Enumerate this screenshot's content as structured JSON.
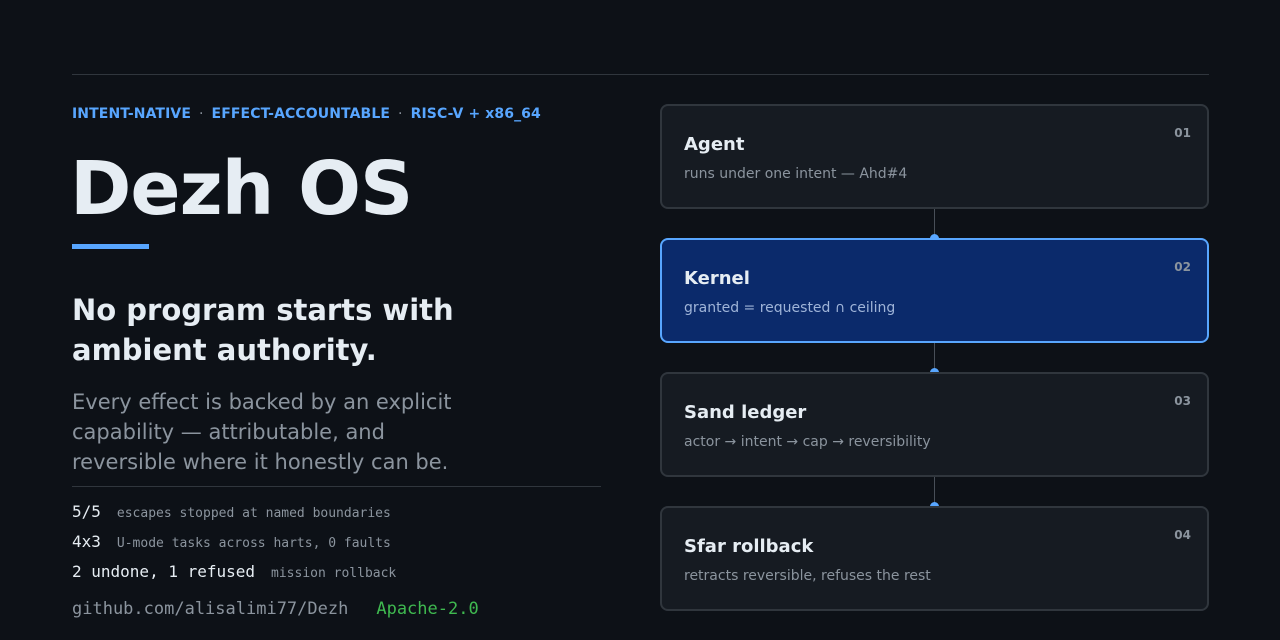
{
  "tagline": {
    "items": [
      "INTENT-NATIVE",
      "EFFECT-ACCOUNTABLE",
      "RISC-V + x86_64"
    ],
    "separator": "·"
  },
  "title": "Dezh OS",
  "headline": "No program starts with ambient authority.",
  "lede": "Every effect is backed by an explicit capability — attributable, and reversible where it honestly can be.",
  "stats": [
    {
      "value": "5/5",
      "desc": "escapes stopped at named boundaries"
    },
    {
      "value": "4x3",
      "desc": "U-mode tasks across harts, 0 faults"
    },
    {
      "value": "2 undone, 1 refused",
      "desc": "mission rollback"
    }
  ],
  "footer": {
    "repo": "github.com/alisalimi77/Dezh",
    "license": "Apache-2.0"
  },
  "pipeline": [
    {
      "num": "01",
      "title": "Agent",
      "subtitle": "runs under one intent — Ahd#4",
      "active": false
    },
    {
      "num": "02",
      "title": "Kernel",
      "subtitle": "granted = requested ∩ ceiling",
      "active": true
    },
    {
      "num": "03",
      "title": "Sand ledger",
      "subtitle": "actor → intent → cap → reversibility",
      "active": false
    },
    {
      "num": "04",
      "title": "Sfar rollback",
      "subtitle": "retracts reversible, refuses the rest",
      "active": false
    }
  ],
  "colors": {
    "background": "#0d1117",
    "accent": "#58a6ff",
    "active_step": "#0b2a6b",
    "license": "#3fb950"
  }
}
